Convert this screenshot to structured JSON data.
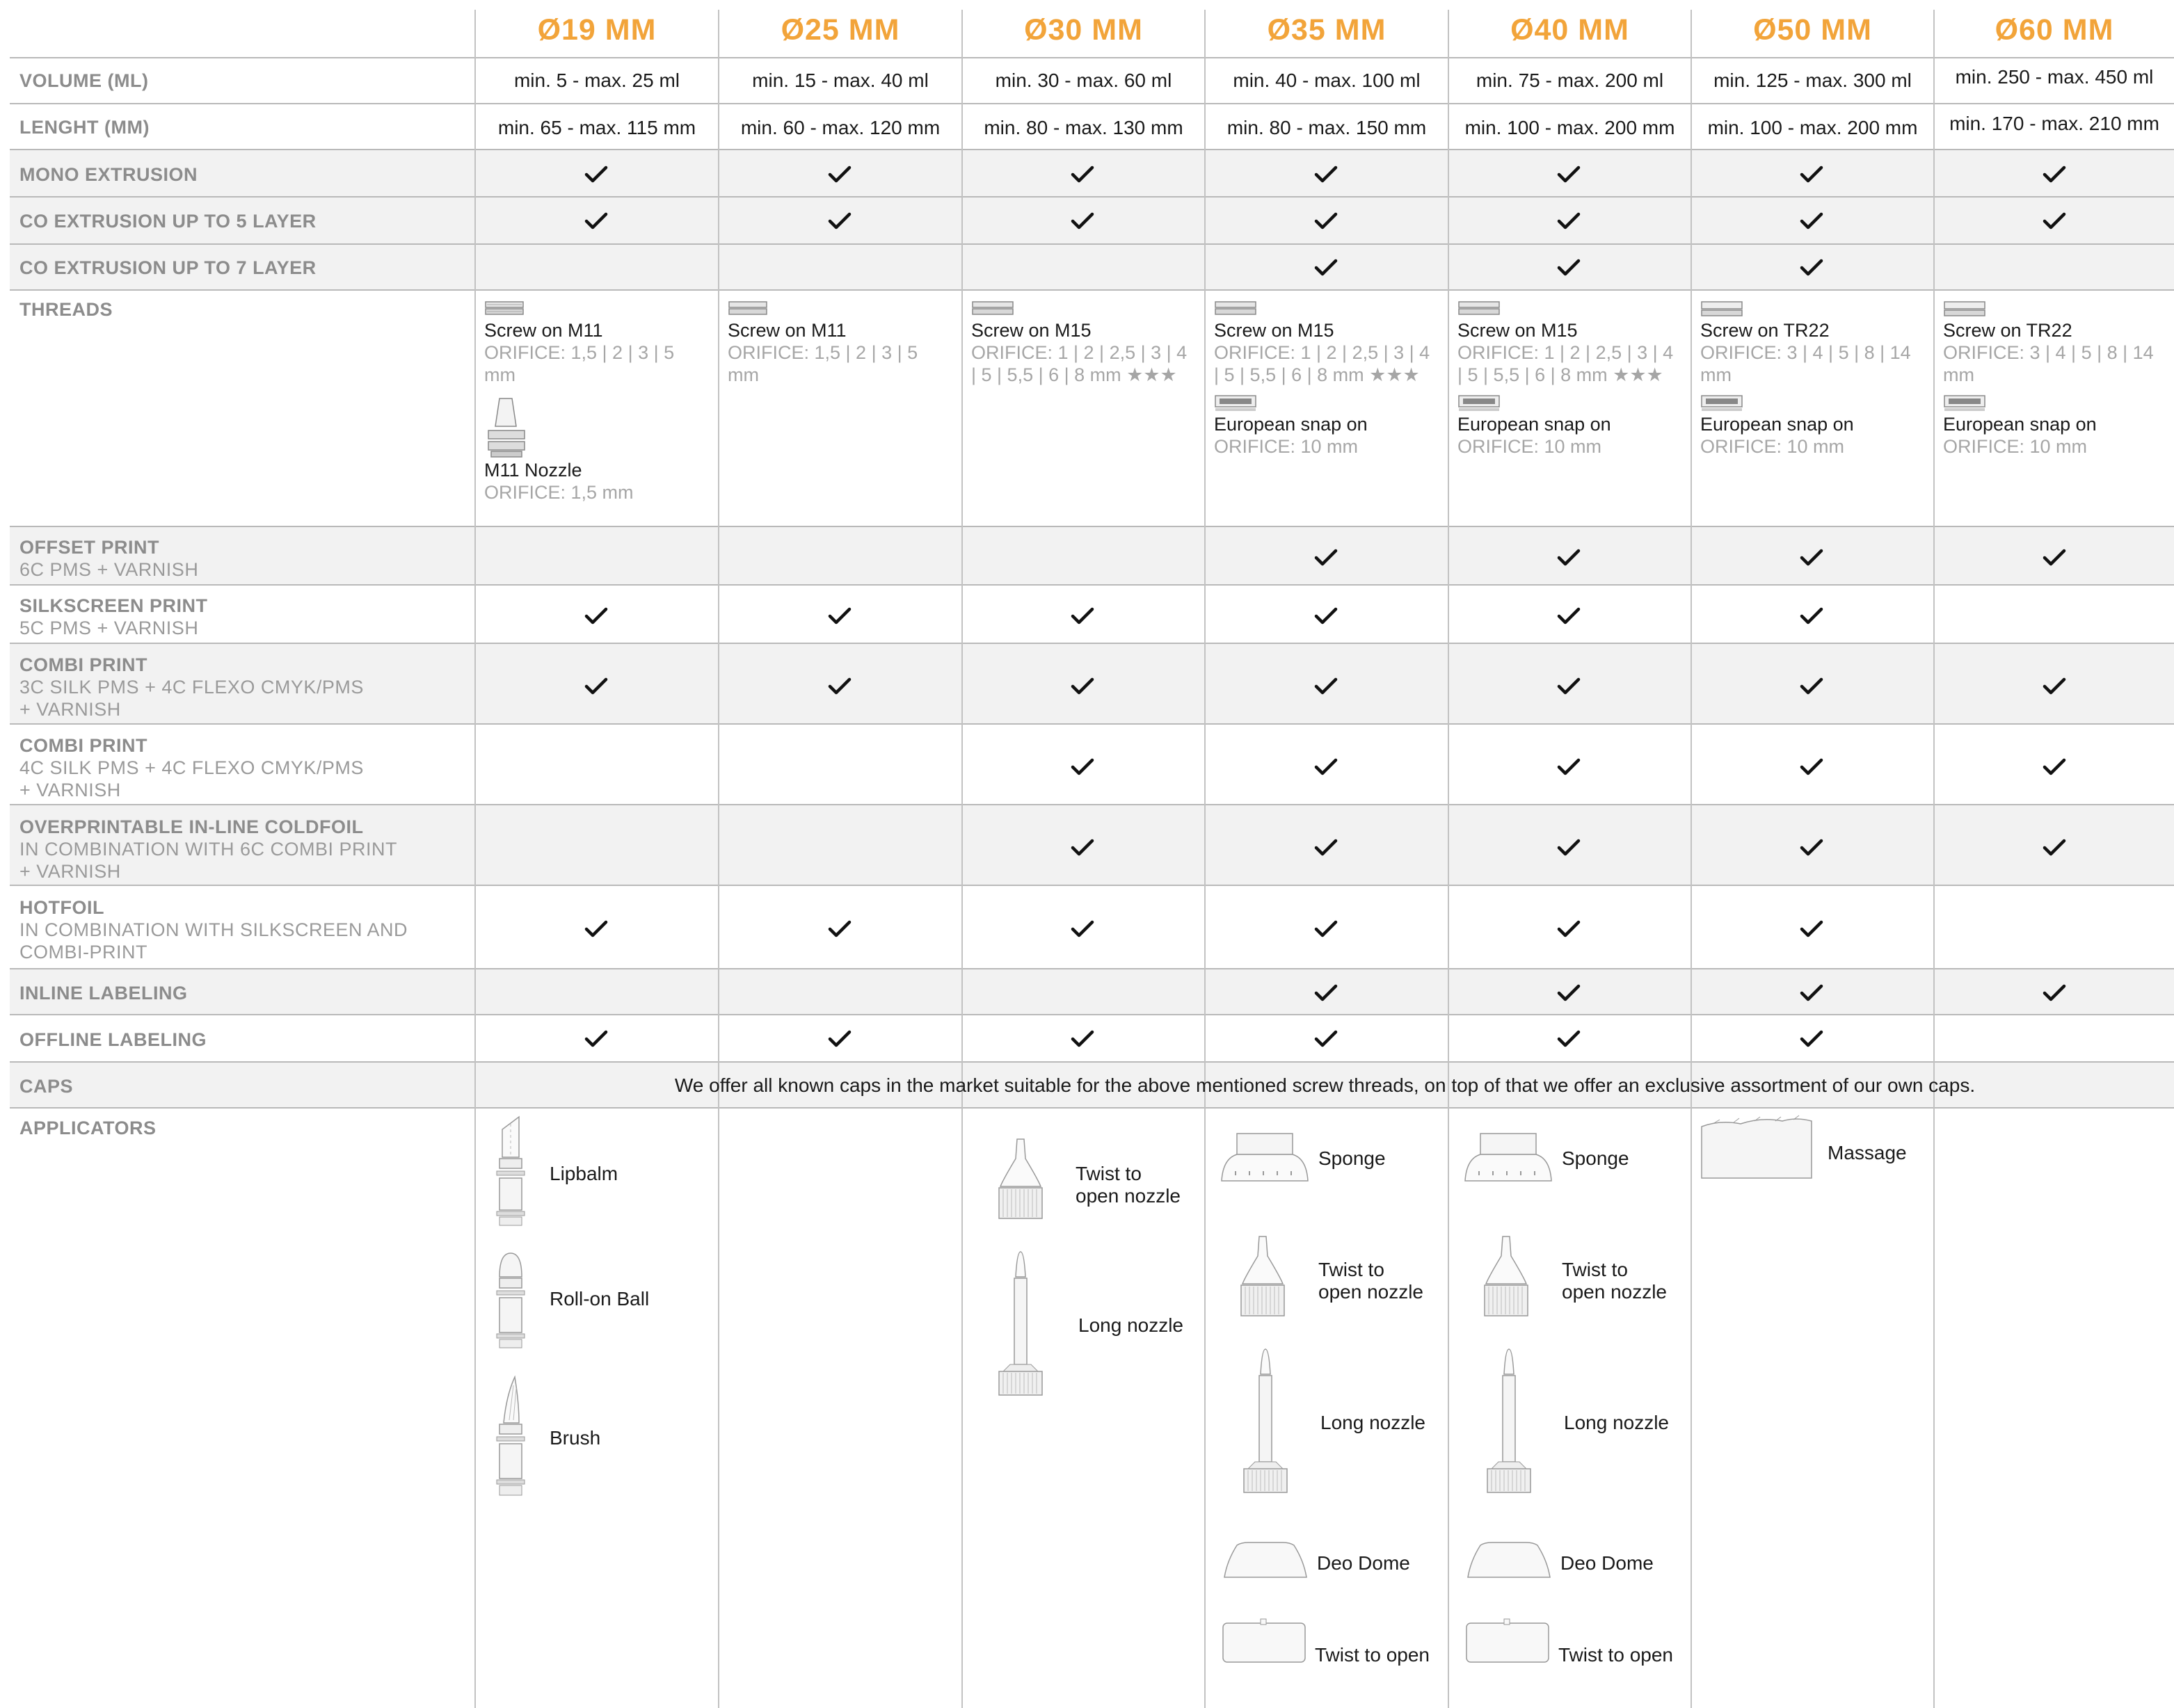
{
  "columns": [
    "Ø19 MM",
    "Ø25 MM",
    "Ø30 MM",
    "Ø35 MM",
    "Ø40 MM",
    "Ø50 MM",
    "Ø60 MM"
  ],
  "volume": {
    "label": "VOLUME (ML)",
    "values": [
      "min. 5 - max. 25 ml",
      "min. 15 - max. 40 ml",
      "min. 30 - max. 60 ml",
      "min. 40 - max. 100 ml",
      "min. 75 - max. 200 ml",
      "min. 125 - max. 300 ml",
      "min. 250 - max. 450 ml"
    ]
  },
  "length": {
    "label": "LENGHT (MM)",
    "values": [
      "min. 65 - max. 115 mm",
      "min. 60 - max. 120 mm",
      "min. 80 - max. 130 mm",
      "min. 80 - max. 150 mm",
      "min. 100 - max. 200 mm",
      "min. 100 - max. 200 mm",
      "min. 170 - max. 210 mm"
    ]
  },
  "rows": {
    "mono": {
      "label": "MONO EXTRUSION",
      "checks": [
        1,
        1,
        1,
        1,
        1,
        1,
        1
      ]
    },
    "co5": {
      "label": "CO EXTRUSION UP TO 5 LAYER",
      "checks": [
        1,
        1,
        1,
        1,
        1,
        1,
        1
      ]
    },
    "co7": {
      "label": "CO EXTRUSION UP TO 7 LAYER",
      "checks": [
        0,
        0,
        0,
        1,
        1,
        1,
        0
      ]
    },
    "offset": {
      "label": "OFFSET PRINT",
      "sub": "6C PMS + VARNISH",
      "checks": [
        0,
        0,
        0,
        1,
        1,
        1,
        1
      ]
    },
    "silk": {
      "label": "SILKSCREEN PRINT",
      "sub": "5C PMS + VARNISH",
      "checks": [
        1,
        1,
        1,
        1,
        1,
        1,
        0
      ]
    },
    "combi3": {
      "label": "COMBI PRINT",
      "sub1": "3C SILK PMS + 4C FLEXO CMYK/PMS",
      "sub2": "+ VARNISH",
      "checks": [
        1,
        1,
        1,
        1,
        1,
        1,
        1
      ]
    },
    "combi4": {
      "label": "COMBI PRINT",
      "sub1": "4C SILK PMS + 4C FLEXO CMYK/PMS",
      "sub2": "+ VARNISH",
      "checks": [
        0,
        0,
        1,
        1,
        1,
        1,
        1
      ]
    },
    "coldfoil": {
      "label": "OVERPRINTABLE IN-LINE COLDFOIL",
      "sub1": "IN COMBINATION WITH 6C COMBI PRINT",
      "sub2": "+ VARNISH",
      "checks": [
        0,
        0,
        1,
        1,
        1,
        1,
        1
      ]
    },
    "hotfoil": {
      "label": "HOTFOIL",
      "sub1": "IN COMBINATION WITH SILKSCREEN AND",
      "sub2": "COMBI-PRINT",
      "checks": [
        1,
        1,
        1,
        1,
        1,
        1,
        0
      ]
    },
    "inline": {
      "label": "INLINE LABELING",
      "checks": [
        0,
        0,
        0,
        1,
        1,
        1,
        1
      ]
    },
    "offline": {
      "label": "OFFLINE LABELING",
      "checks": [
        1,
        1,
        1,
        1,
        1,
        1,
        0
      ]
    }
  },
  "threads": {
    "label": "THREADS",
    "cols": [
      {
        "name": "Screw on M11",
        "orifice": [
          "ORIFICE: 1,5 | 2 | 3 | 5",
          "mm"
        ],
        "extra_name": "M11 Nozzle",
        "extra_orifice": "ORIFICE: 1,5 mm"
      },
      {
        "name": "Screw on M11",
        "orifice": [
          "ORIFICE: 1,5 | 2 | 3 | 5",
          "mm"
        ]
      },
      {
        "name": "Screw on M15",
        "orifice": [
          "ORIFICE: 1 | 2 | 2,5 | 3 | 4",
          "| 5 | 5,5 | 6 | 8 mm ★★★"
        ]
      },
      {
        "name": "Screw on M15",
        "orifice": [
          "ORIFICE: 1 | 2 | 2,5 | 3 | 4",
          "| 5 | 5,5 | 6 | 8 mm ★★★"
        ],
        "extra_name": "European snap on",
        "extra_orifice": "ORIFICE: 10 mm"
      },
      {
        "name": "Screw on M15",
        "orifice": [
          "ORIFICE: 1 | 2 | 2,5 | 3 | 4",
          "| 5 | 5,5 | 6 | 8 mm ★★★"
        ],
        "extra_name": "European snap on",
        "extra_orifice": "ORIFICE: 10 mm"
      },
      {
        "name": "Screw on TR22",
        "orifice": [
          "ORIFICE: 3 | 4 | 5 | 8 | 14",
          "mm"
        ],
        "extra_name": "European snap on",
        "extra_orifice": "ORIFICE: 10 mm"
      },
      {
        "name": "Screw on TR22",
        "orifice": [
          "ORIFICE: 3 | 4 | 5 | 8 | 14",
          "mm"
        ],
        "extra_name": "European snap on",
        "extra_orifice": "ORIFICE: 10 mm"
      }
    ]
  },
  "caps": {
    "label": "CAPS",
    "text": "We offer all known caps in the market suitable for the above mentioned screw threads, on top of that we offer an exclusive assortment of our own caps."
  },
  "applicators": {
    "label": "APPLICATORS",
    "c19": [
      "Lipbalm",
      "Roll-on Ball",
      "Brush"
    ],
    "c30": {
      "twist1": "Twist to",
      "twist2": "open nozzle",
      "long": "Long nozzle"
    },
    "c35": {
      "sponge": "Sponge",
      "twist1": "Twist to",
      "twist2": "open nozzle",
      "long": "Long nozzle",
      "deo": "Deo Dome",
      "twistopen": "Twist to open"
    },
    "c40": {
      "sponge": "Sponge",
      "twist1": "Twist to",
      "twist2": "open nozzle",
      "long": "Long nozzle",
      "deo": "Deo Dome",
      "twistopen": "Twist to open"
    },
    "c50": {
      "massage": "Massage"
    }
  },
  "colors": {
    "accent": "#f2a43a",
    "label_gray": "#8c8c8c",
    "orifice_gray": "#a6a6a6",
    "row_shade": "#f2f2f2",
    "rule": "#b9b9b9"
  }
}
